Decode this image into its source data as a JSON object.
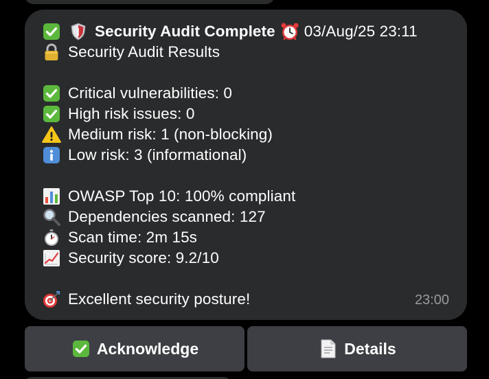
{
  "message": {
    "header": {
      "title": "Security Audit Complete",
      "datetime": "03/Aug/25 23:11",
      "icons": [
        "check-mark-icon",
        "shield-icon",
        "alarm-clock-icon"
      ]
    },
    "subtitle": "Security Audit Results",
    "findings": [
      {
        "icon": "check-mark-icon",
        "text": "Critical vulnerabilities: 0"
      },
      {
        "icon": "check-mark-icon",
        "text": "High risk issues: 0"
      },
      {
        "icon": "warning-icon",
        "text": "Medium risk: 1 (non-blocking)"
      },
      {
        "icon": "info-icon",
        "text": "Low risk: 3 (informational)"
      }
    ],
    "stats": [
      {
        "icon": "bar-chart-icon",
        "text": "OWASP Top 10: 100% compliant"
      },
      {
        "icon": "magnifier-icon",
        "text": "Dependencies scanned: 127"
      },
      {
        "icon": "stopwatch-icon",
        "text": "Scan time: 2m 15s"
      },
      {
        "icon": "trend-up-chart-icon",
        "text": "Security score: 9.2/10"
      }
    ],
    "footer": {
      "icon": "target-icon",
      "text": "Excellent security posture!"
    },
    "time": "23:00"
  },
  "buttons": {
    "acknowledge": {
      "label": "Acknowledge",
      "icon": "check-mark-icon"
    },
    "details": {
      "label": "Details",
      "icon": "document-icon"
    }
  },
  "colors": {
    "background": "#000000",
    "bubble": "#2a2b2d",
    "button": "#3d3f44",
    "check_green": "#5cb83d",
    "time_gray": "#9a9a9f"
  }
}
